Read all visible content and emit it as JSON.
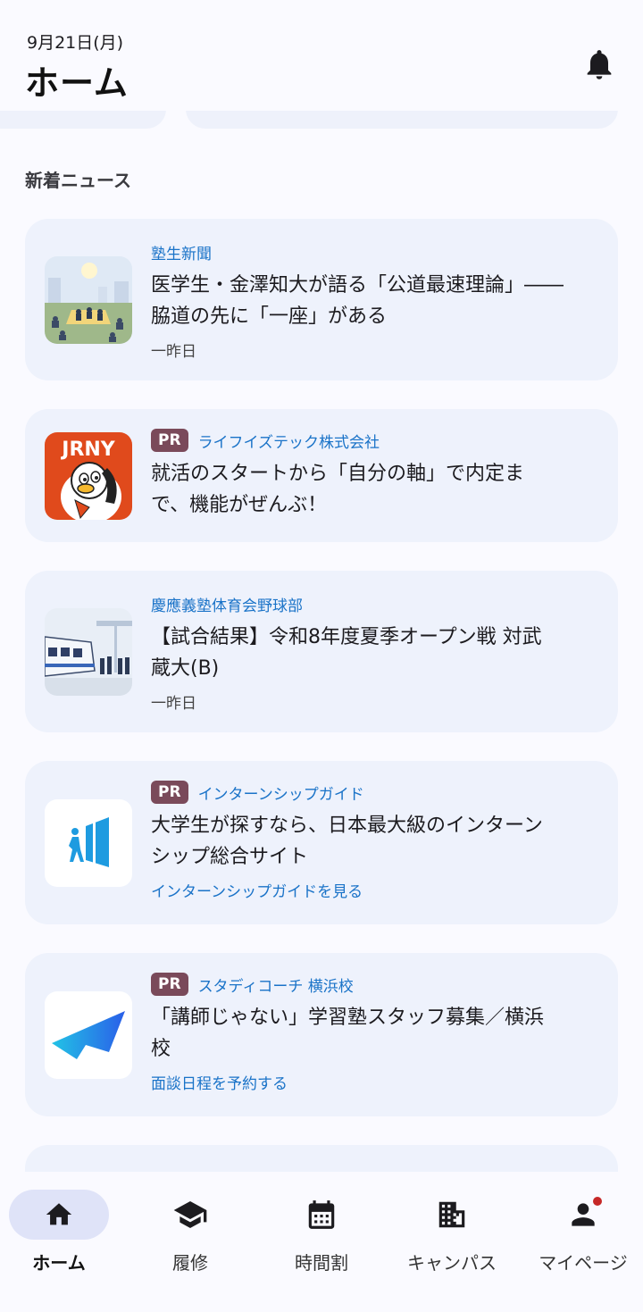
{
  "header": {
    "date": "9月21日(月)",
    "title": "ホーム",
    "notification_icon": "bell-icon"
  },
  "news": {
    "section_title": "新着ニュース",
    "items": [
      {
        "source": "塾生新聞",
        "headline_line1": "医学生・金澤知大が語る「公道最速理論」――",
        "headline_line2": "脇道の先に「一座」がある",
        "meta": "一昨日",
        "thumbnail": "students-sitting-outdoors-illustration"
      },
      {
        "pr": "PR",
        "source": "ライフイズテック株式会社",
        "headline_line1": "就活のスタートから「自分の軸」で内定ま",
        "headline_line2": "で、機能がぜんぶ！",
        "thumbnail": "jrny-penguin-logo",
        "thumbnail_text": "JRNY"
      },
      {
        "source": "慶應義塾体育会野球部",
        "headline_line1": "【試合結果】令和8年度夏季オープン戦 対武",
        "headline_line2": "蔵大(B)",
        "meta": "一昨日",
        "thumbnail": "train-station-illustration"
      },
      {
        "pr": "PR",
        "source": "インターンシップガイド",
        "headline_line1": "大学生が探すなら、日本最大級のインターン",
        "headline_line2": "シップ総合サイト",
        "link": "インターンシップガイドを見る",
        "thumbnail": "internship-guide-logo"
      },
      {
        "pr": "PR",
        "source": "スタディコーチ 横浜校",
        "headline_line1": "「講師じゃない」学習塾スタッフ募集／横浜",
        "headline_line2": "校",
        "link": "面談日程を予約する",
        "thumbnail": "studycoach-logo"
      }
    ]
  },
  "bottom_nav": {
    "items": [
      {
        "label": "ホーム",
        "icon": "home-icon",
        "active": true
      },
      {
        "label": "履修",
        "icon": "graduation-cap-icon"
      },
      {
        "label": "時間割",
        "icon": "calendar-icon"
      },
      {
        "label": "キャンパス",
        "icon": "building-icon"
      },
      {
        "label": "マイページ",
        "icon": "person-icon",
        "badge": true
      }
    ]
  },
  "colors": {
    "background": "#fafaff",
    "card": "#eef2fc",
    "accent_link": "#1a73c8",
    "pr_badge": "#7a4a5a",
    "nav_active": "#dfe3f8",
    "notification_dot": "#c62828"
  }
}
